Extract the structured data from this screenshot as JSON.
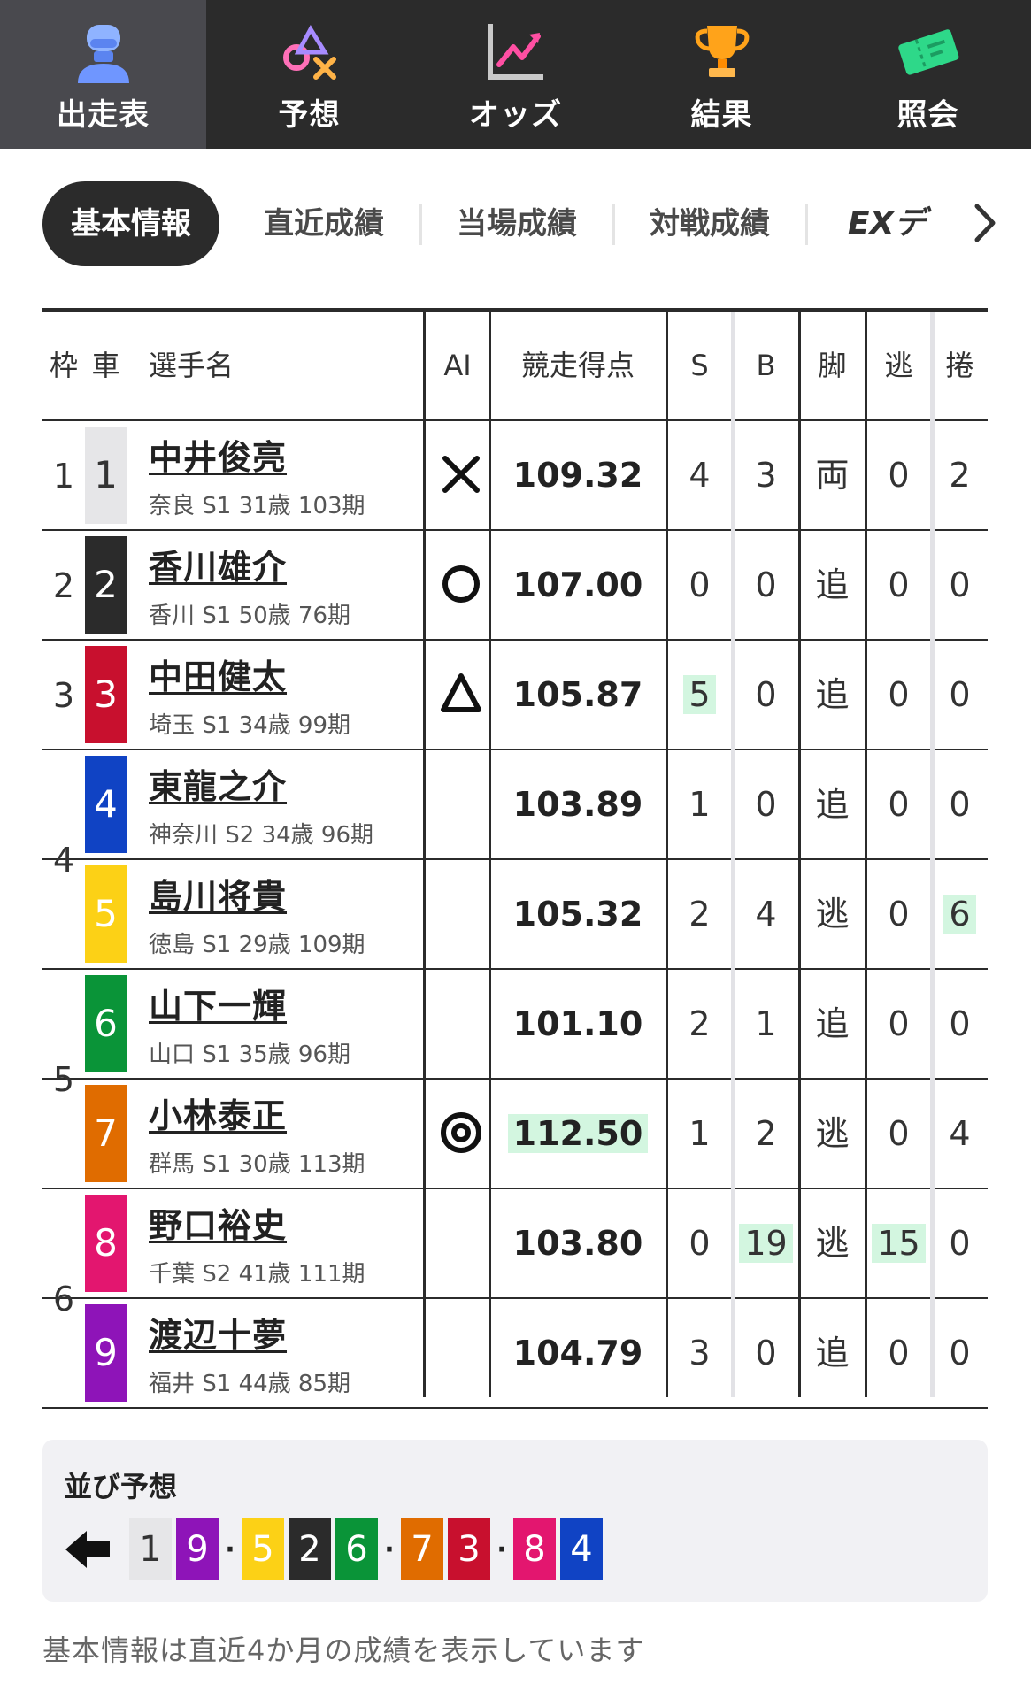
{
  "nav": {
    "items": [
      {
        "label": "出走表",
        "icon": "racer-helmet-icon"
      },
      {
        "label": "予想",
        "icon": "prediction-symbols-icon"
      },
      {
        "label": "オッズ",
        "icon": "odds-chart-icon"
      },
      {
        "label": "結果",
        "icon": "trophy-icon"
      },
      {
        "label": "照会",
        "icon": "ticket-icon"
      }
    ],
    "active_index": 0
  },
  "subtabs": {
    "items": [
      "基本情報",
      "直近成績",
      "当場成績",
      "対戦成績"
    ],
    "ex_label": "EXデ",
    "active_index": 0
  },
  "table": {
    "headers": {
      "frame": "枠",
      "car": "車",
      "name": "選手名",
      "ai": "AI",
      "score": "競走得点",
      "s": "S",
      "b": "B",
      "leg": "脚",
      "nige": "逃",
      "makuri": "捲"
    },
    "rows": [
      {
        "frame": "1",
        "car": "1",
        "name": "中井俊亮",
        "meta": "奈良 S1 31歳 103期",
        "ai": "×",
        "score": "109.32",
        "s": "4",
        "b": "3",
        "leg": "両",
        "nige": "0",
        "makuri": "2"
      },
      {
        "frame": "2",
        "car": "2",
        "name": "香川雄介",
        "meta": "香川 S1 50歳 76期",
        "ai": "○",
        "score": "107.00",
        "s": "0",
        "b": "0",
        "leg": "追",
        "nige": "0",
        "makuri": "0"
      },
      {
        "frame": "3",
        "car": "3",
        "name": "中田健太",
        "meta": "埼玉 S1 34歳 99期",
        "ai": "△",
        "score": "105.87",
        "s": "5",
        "b": "0",
        "leg": "追",
        "nige": "0",
        "makuri": "0"
      },
      {
        "frame": "4",
        "car": "4",
        "name": "東龍之介",
        "meta": "神奈川 S2 34歳 96期",
        "ai": "",
        "score": "103.89",
        "s": "1",
        "b": "0",
        "leg": "追",
        "nige": "0",
        "makuri": "0"
      },
      {
        "frame": "",
        "car": "5",
        "name": "島川将貴",
        "meta": "徳島 S1 29歳 109期",
        "ai": "",
        "score": "105.32",
        "s": "2",
        "b": "4",
        "leg": "逃",
        "nige": "0",
        "makuri": "6"
      },
      {
        "frame": "5",
        "car": "6",
        "name": "山下一輝",
        "meta": "山口 S1 35歳 96期",
        "ai": "",
        "score": "101.10",
        "s": "2",
        "b": "1",
        "leg": "追",
        "nige": "0",
        "makuri": "0"
      },
      {
        "frame": "",
        "car": "7",
        "name": "小林泰正",
        "meta": "群馬 S1 30歳 113期",
        "ai": "◎",
        "score": "112.50",
        "s": "1",
        "b": "2",
        "leg": "逃",
        "nige": "0",
        "makuri": "4"
      },
      {
        "frame": "6",
        "car": "8",
        "name": "野口裕史",
        "meta": "千葉 S2 41歳 111期",
        "ai": "",
        "score": "103.80",
        "s": "0",
        "b": "19",
        "leg": "逃",
        "nige": "15",
        "makuri": "0"
      },
      {
        "frame": "",
        "car": "9",
        "name": "渡辺十夢",
        "meta": "福井 S1 44歳 85期",
        "ai": "",
        "score": "104.79",
        "s": "3",
        "b": "0",
        "leg": "追",
        "nige": "0",
        "makuri": "0"
      }
    ]
  },
  "narabi": {
    "title": "並び予想",
    "sequence": [
      "1",
      "9",
      "·",
      "5",
      "2",
      "6",
      "·",
      "7",
      "3",
      "·",
      "8",
      "4"
    ]
  },
  "footnote": "基本情報は直近4か月の成績を表示しています",
  "colors": {
    "nav_bg": "#2b2b2b",
    "nav_active": "#49494e",
    "highlight": "#d3f6e0",
    "car_1": "#e6e6e8",
    "car_2": "#2b2b2b",
    "car_3": "#c8102e",
    "car_4": "#1043c4",
    "car_5": "#fcd116",
    "car_6": "#0a9438",
    "car_7": "#e06c00",
    "car_8": "#e3166f",
    "car_9": "#8e14b8"
  }
}
